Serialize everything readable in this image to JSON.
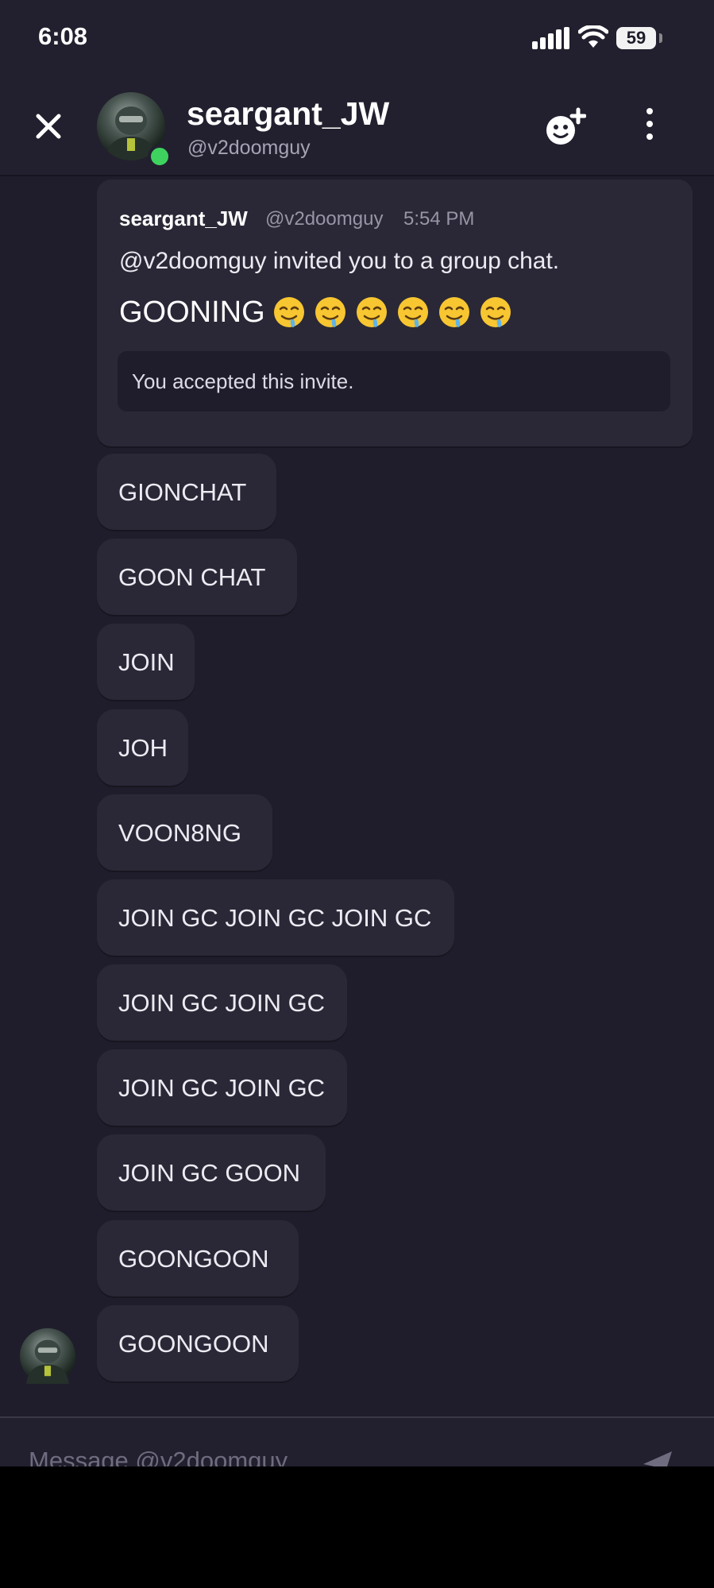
{
  "status_bar": {
    "time": "6:08",
    "battery": "59"
  },
  "header": {
    "name": "seargant_JW",
    "handle": "@v2doomguy",
    "online": true
  },
  "invite": {
    "author": "seargant_JW",
    "handle": "@v2doomguy",
    "time": "5:54 PM",
    "text": "@v2doomguy invited you to a group chat.",
    "group_name": "GOONING",
    "emoji_count": 6,
    "status": "You accepted this invite."
  },
  "messages": [
    {
      "text": "GIONCHAT"
    },
    {
      "text": "GOON CHAT"
    },
    {
      "text": "JOIN"
    },
    {
      "text": "JOH"
    },
    {
      "text": "VOON8NG"
    },
    {
      "text": "JOIN GC JOIN GC JOIN GC"
    },
    {
      "text": "JOIN GC JOIN GC"
    },
    {
      "text": "JOIN GC JOIN GC"
    },
    {
      "text": "JOIN GC GOON"
    },
    {
      "text": "GOONGOON"
    },
    {
      "text": "GOONGOON"
    }
  ],
  "composer": {
    "placeholder": "Message @v2doomguy"
  },
  "colors": {
    "background": "#1f1d2b",
    "bubble": "#2a2836",
    "online": "#3ed35f"
  },
  "icons": [
    "close-icon",
    "add-friend-icon",
    "more-vertical-icon",
    "send-icon",
    "signal-icon",
    "wifi-icon",
    "battery-icon",
    "drooling-face-emoji"
  ]
}
